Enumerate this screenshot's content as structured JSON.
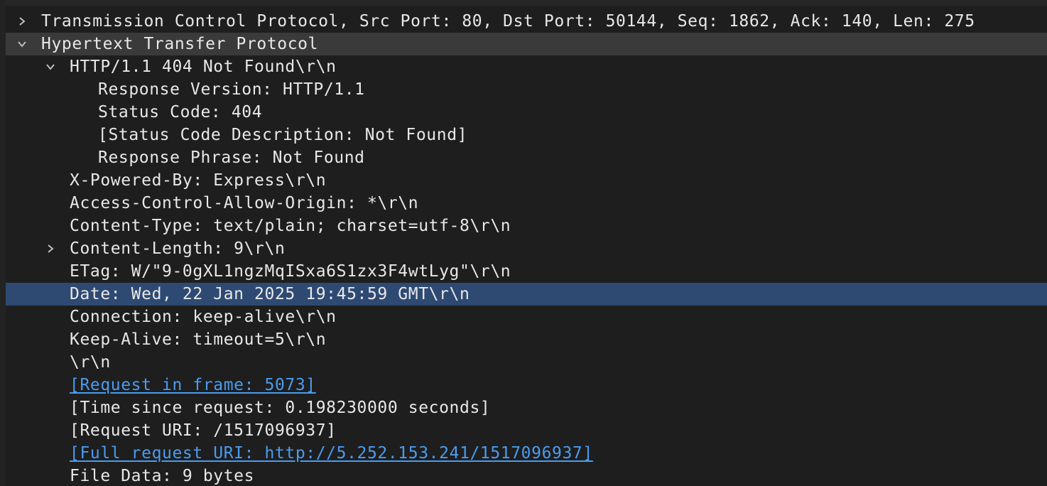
{
  "packet_details": {
    "tcp": {
      "label": "Transmission Control Protocol, Src Port: 80, Dst Port: 50144, Seq: 1862, Ack: 140, Len: 275",
      "toggle_icon": "chevron-right-icon"
    },
    "http": {
      "label": "Hypertext Transfer Protocol",
      "toggle_icon": "chevron-down-icon",
      "status_line": {
        "label": "HTTP/1.1 404 Not Found\\r\\n",
        "toggle_icon": "chevron-down-icon",
        "children": [
          "Response Version: HTTP/1.1",
          "Status Code: 404",
          "[Status Code Description: Not Found]",
          "Response Phrase: Not Found"
        ]
      },
      "headers": {
        "x_powered_by": "X-Powered-By: Express\\r\\n",
        "access_control": "Access-Control-Allow-Origin: *\\r\\n",
        "content_type": "Content-Type: text/plain; charset=utf-8\\r\\n",
        "content_length": "Content-Length: 9\\r\\n",
        "etag": "ETag: W/\"9-0gXL1ngzMqISxa6S1zx3F4wtLyg\"\\r\\n",
        "date": "Date: Wed, 22 Jan 2025 19:45:59 GMT\\r\\n",
        "connection": "Connection: keep-alive\\r\\n",
        "keep_alive": "Keep-Alive: timeout=5\\r\\n",
        "end": "\\r\\n"
      },
      "content_length_toggle_icon": "chevron-right-icon",
      "request_in_frame": "[Request in frame: 5073]",
      "time_since_request": "[Time since request: 0.198230000 seconds]",
      "request_uri": "[Request URI: /1517096937]",
      "full_request_uri": "[Full request URI: http://5.252.153.241/1517096937]",
      "file_data": "File Data: 9 bytes"
    }
  },
  "colors": {
    "background": "#1e1e1e",
    "text": "#e8e8e8",
    "link": "#4a9cf0",
    "selected_row": "#2e4a73",
    "expanded_header_row": "#3a3a3a"
  }
}
